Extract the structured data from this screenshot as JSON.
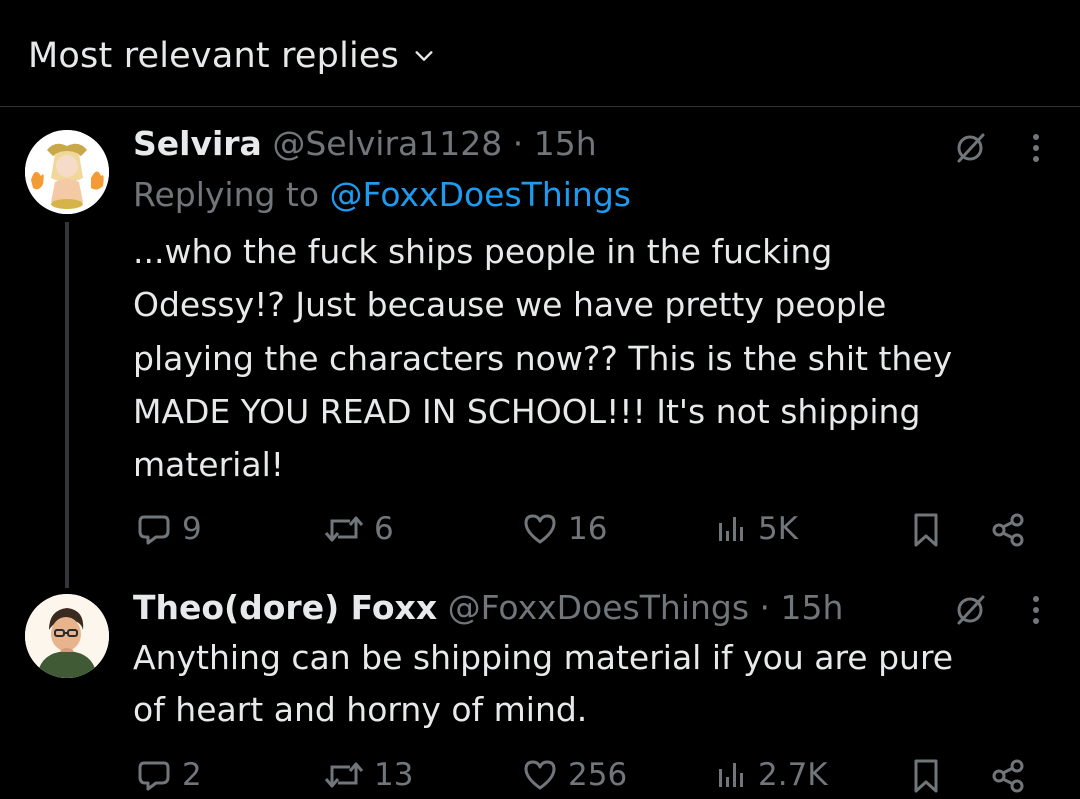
{
  "header": {
    "label": "Most relevant replies"
  },
  "replies": [
    {
      "name": "Selvira",
      "handle": "@Selvira1128",
      "separator": "·",
      "time": "15h",
      "replying_prefix": "Replying to",
      "replying_handle": "@FoxxDoesThings",
      "text_lines": [
        "...who the fuck ships people in the fucking",
        "Odessy!? Just because we have pretty people",
        "playing the characters now?? This is the shit they",
        "MADE YOU READ IN SCHOOL!!! It's not shipping",
        "material!"
      ],
      "stats": {
        "replies": "9",
        "reposts": "6",
        "likes": "16",
        "views": "5K"
      }
    },
    {
      "name": "Theo(dore) Foxx",
      "handle": "@FoxxDoesThings",
      "separator": "·",
      "time": "15h",
      "text_lines": [
        "Anything can be shipping material if you are pure",
        "of heart and horny of mind."
      ],
      "stats": {
        "replies": "2",
        "reposts": "13",
        "likes": "256",
        "views": "2.7K"
      }
    }
  ],
  "colors": {
    "background": "#000000",
    "primary_text": "#e7e9ea",
    "secondary_text": "#71767b",
    "link": "#1d9bf0",
    "divider": "#2f3336"
  }
}
